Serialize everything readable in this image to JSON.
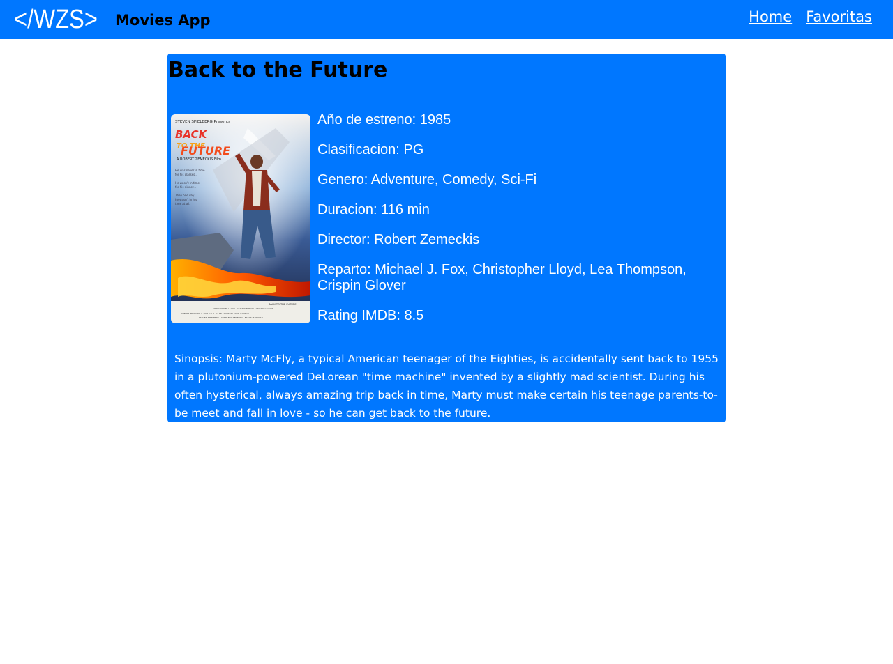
{
  "header": {
    "logo_text": "</WZS>",
    "app_title": "Movies App",
    "nav": [
      {
        "label": "Home"
      },
      {
        "label": "Favoritas"
      }
    ]
  },
  "movie": {
    "title": "Back to the Future",
    "poster_title": "BACK TO THE FUTURE",
    "details": [
      {
        "label": "Año de estreno: 1985"
      },
      {
        "label": "Clasificacion: PG"
      },
      {
        "label": "Genero: Adventure, Comedy, Sci-Fi"
      },
      {
        "label": "Duracion: 116 min"
      },
      {
        "label": "Director: Robert Zemeckis"
      },
      {
        "label": "Reparto: Michael J. Fox, Christopher Lloyd, Lea Thompson, Crispin Glover"
      },
      {
        "label": "Rating IMDB: 8.5"
      }
    ],
    "synopsis": "Sinopsis: Marty McFly, a typical American teenager of the Eighties, is accidentally sent back to 1955 in a plutonium-powered DeLorean \"time machine\" invented by a slightly mad scientist. During his often hysterical, always amazing trip back in time, Marty must make certain his teenage parents-to-be meet and fall in love - so he can get back to the future."
  },
  "colors": {
    "primary": "#0077ff",
    "text_light": "#ffffff",
    "text_dark": "#000000"
  }
}
